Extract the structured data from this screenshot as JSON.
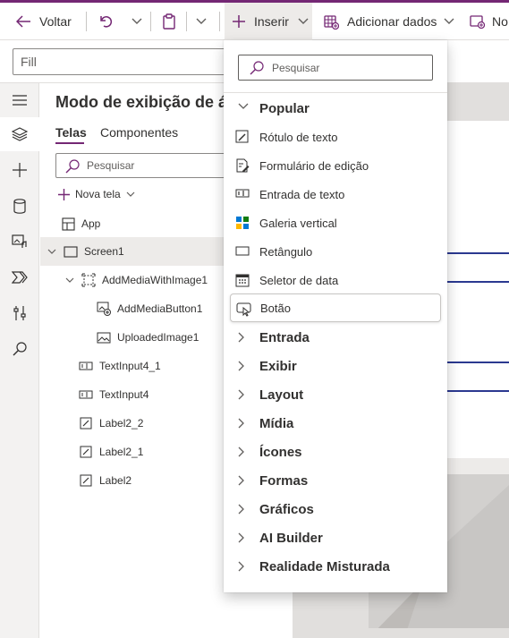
{
  "toolbar": {
    "back_label": "Voltar",
    "insert_label": "Inserir",
    "add_data_label": "Adicionar dados",
    "new_label_partial": "No"
  },
  "formula": {
    "property_value": "Fill"
  },
  "tree": {
    "title": "Modo de exibição de á",
    "tabs": [
      "Telas",
      "Componentes"
    ],
    "search_placeholder": "Pesquisar",
    "new_screen_label": "Nova tela",
    "items": [
      {
        "label": "App",
        "icon": "app-icon"
      },
      {
        "label": "Screen1",
        "icon": "screen-icon"
      },
      {
        "label": "AddMediaWithImage1",
        "icon": "group-icon"
      },
      {
        "label": "AddMediaButton1",
        "icon": "add-media-icon"
      },
      {
        "label": "UploadedImage1",
        "icon": "image-icon"
      },
      {
        "label": "TextInput4_1",
        "icon": "text-input-icon"
      },
      {
        "label": "TextInput4",
        "icon": "text-input-icon"
      },
      {
        "label": "Label2_2",
        "icon": "label-icon"
      },
      {
        "label": "Label2_1",
        "icon": "label-icon"
      },
      {
        "label": "Label2",
        "icon": "label-icon"
      }
    ]
  },
  "insert_menu": {
    "search_placeholder": "Pesquisar",
    "popular_header": "Popular",
    "popular_items": [
      {
        "label": "Rótulo de texto",
        "icon": "label-icon"
      },
      {
        "label": "Formulário de edição",
        "icon": "edit-form-icon"
      },
      {
        "label": "Entrada de texto",
        "icon": "text-input-icon"
      },
      {
        "label": "Galeria vertical",
        "icon": "gallery-icon"
      },
      {
        "label": "Retângulo",
        "icon": "rectangle-icon"
      },
      {
        "label": "Seletor de data",
        "icon": "calendar-icon"
      },
      {
        "label": "Botão",
        "icon": "button-icon"
      }
    ],
    "categories": [
      "Entrada",
      "Exibir",
      "Layout",
      "Mídia",
      "Ícones",
      "Formas",
      "Gráficos",
      "AI Builder",
      "Realidade Misturada"
    ]
  },
  "colors": {
    "accent": "#742774",
    "canvas_line": "#2b3990"
  }
}
